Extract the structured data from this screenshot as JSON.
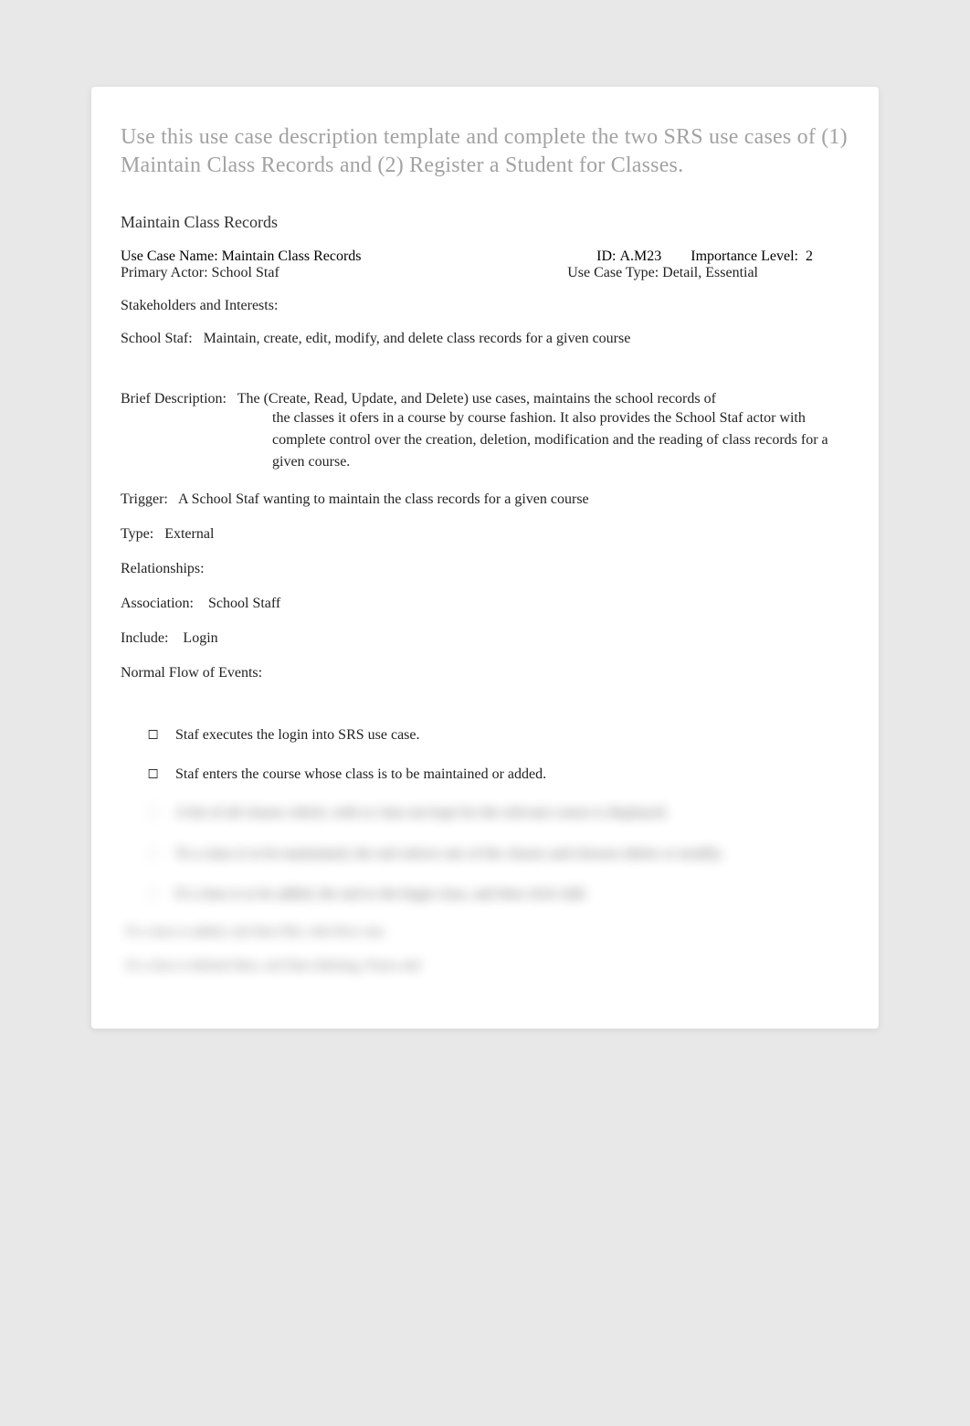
{
  "intro": "Use this use case description template and complete the two SRS use cases of (1) Maintain Class Records and (2) Register a Student for Classes.",
  "section_title": "Maintain Class Records",
  "fields": {
    "use_case_name_label": "Use Case Name:",
    "use_case_name_value": "Maintain Class Records",
    "id_label": "ID:",
    "id_value": "A.M23",
    "importance_label": "Importance Level:",
    "importance_value": "2",
    "primary_actor_label": "Primary Actor:",
    "primary_actor_value": "School Staf",
    "use_case_type_label": "Use Case Type:",
    "use_case_type_value": "Detail, Essential",
    "stakeholders_label": "Stakeholders and Interests:",
    "stakeholder_actor": "School Staf:",
    "stakeholder_interest": "Maintain, create, edit, modify, and delete class records for a given course",
    "brief_label": "Brief Description:",
    "brief_first": "The (Create, Read, Update, and Delete) use cases, maintains the school records of",
    "brief_rest": "the classes it ofers in a course by course fashion.     It also provides the School Staf actor with complete control over the creation, deletion, modification and the reading of class records for a given course.",
    "trigger_label": "Trigger:",
    "trigger_value": "A School Staf wanting to maintain the class records for a given course",
    "type_label": "Type:",
    "type_value": "External",
    "relationships_label": "Relationships:",
    "association_label": "Association:",
    "association_value": "School Staff",
    "include_label": "Include:",
    "include_value": "Login",
    "flow_label": "Normal Flow of Events:"
  },
  "flow": [
    "Staf executes the login into SRS use case.",
    "Staf enters the course whose class is to be maintained or added."
  ],
  "blurred_flow": [
    "A list of all classes which, with or class not kept for the relevant course is displayed.",
    "To a class is to be maintained, the staf selects one of the classes and chooses delete or modify.",
    "If a class is to be added, the staf to the begin class, and then click Add."
  ],
  "blurred_lines": [
    "If a class is added, staf then fills, Sub-flow one.",
    "If a class is deleted then, staf then deleting, Pause and"
  ]
}
